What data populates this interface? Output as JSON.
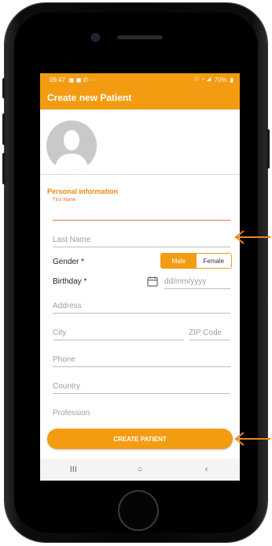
{
  "status_bar": {
    "time": "09:47",
    "left_icons": "▣ ◼ ✆ ···",
    "right_icons": "⛆ ◔ ◢",
    "battery": "70%"
  },
  "app_bar": {
    "title": "Create new Patient"
  },
  "avatar": {
    "icon": "person-silhouette-icon"
  },
  "form": {
    "section_title": "Personal information",
    "first_name": {
      "label": "First Name",
      "value": ""
    },
    "last_name": {
      "placeholder": "Last Name"
    },
    "gender": {
      "label": "Gender *",
      "options": [
        "Male",
        "Female"
      ],
      "selected": "Male"
    },
    "birthday": {
      "label": "Birthday *",
      "placeholder": "dd/mm/yyyy"
    },
    "address": {
      "placeholder": "Address"
    },
    "city": {
      "placeholder": "City"
    },
    "zip": {
      "placeholder": "ZIP Code"
    },
    "phone": {
      "placeholder": "Phone"
    },
    "country": {
      "placeholder": "Country"
    },
    "profession": {
      "placeholder": "Profession"
    }
  },
  "actions": {
    "create_label": "CREATE PATIENT"
  },
  "nav_bar": {
    "recents": "III",
    "home": "○",
    "back": "‹"
  },
  "colors": {
    "accent": "#f39c12",
    "focus_underline": "#e07a40",
    "annotation_arrow": "#f0841e"
  }
}
